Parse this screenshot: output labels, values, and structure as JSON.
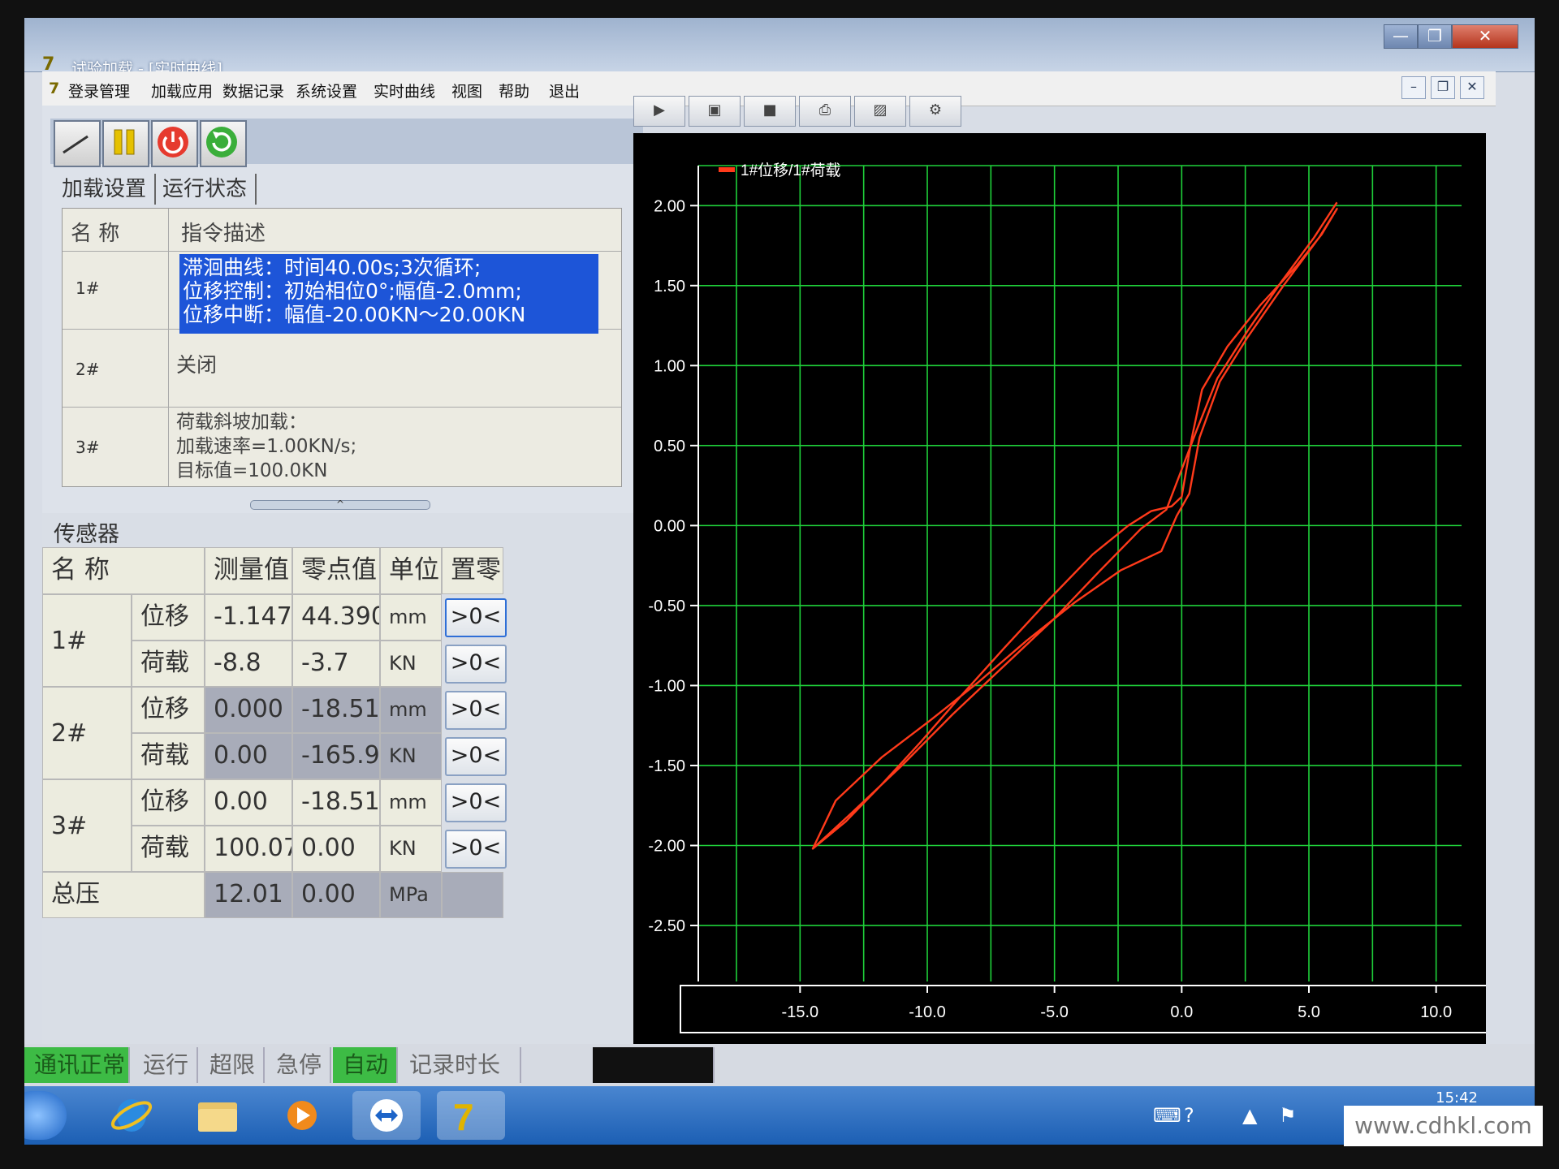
{
  "window": {
    "title": "试验加载 - [实时曲线]",
    "controls": {
      "min": "—",
      "max": "❐",
      "close": "✕"
    },
    "inner_controls": [
      "–",
      "❐",
      "✕"
    ]
  },
  "menu": [
    "登录管理",
    "加载应用",
    "数据记录",
    "系统设置",
    "实时曲线",
    "视图",
    "帮助",
    "退出"
  ],
  "toolbar_icons": [
    "curve-icon",
    "pause-icon",
    "power-icon",
    "refresh-icon"
  ],
  "tabs": [
    "加载设置",
    "运行状态"
  ],
  "command_table": {
    "headers": [
      "名  称",
      "指令描述"
    ],
    "rows": [
      {
        "id": "1#",
        "desc": "滞洄曲线：时间40.00s;3次循环;\n位移控制：初始相位0°;幅值-2.0mm;\n位移中断：幅值-20.00KN～20.00KN"
      },
      {
        "id": "2#",
        "desc": "关闭"
      },
      {
        "id": "3#",
        "desc": "荷载斜坡加载：\n加载速率=1.00KN/s;\n目标值=100.0KN"
      }
    ]
  },
  "splitter_glyph": "^",
  "sensors": {
    "title": "传感器",
    "headers": [
      "名  称",
      "测量值",
      "零点值",
      "单位",
      "置零"
    ],
    "groups": [
      {
        "id": "1#",
        "rows": [
          {
            "name": "位移",
            "value": "-1.147",
            "zero": "44.390",
            "unit": "mm",
            "btn": ">0<"
          },
          {
            "name": "荷载",
            "value": "-8.8",
            "zero": "-3.7",
            "unit": "KN",
            "btn": ">0<"
          }
        ]
      },
      {
        "id": "2#",
        "rows": [
          {
            "name": "位移",
            "value": "0.000",
            "zero": "-18.51",
            "unit": "mm",
            "btn": ">0<"
          },
          {
            "name": "荷载",
            "value": "0.00",
            "zero": "-165.9",
            "unit": "KN",
            "btn": ">0<"
          }
        ]
      },
      {
        "id": "3#",
        "rows": [
          {
            "name": "位移",
            "value": "0.00",
            "zero": "-18.51",
            "unit": "mm",
            "btn": ">0<"
          },
          {
            "name": "荷载",
            "value": "100.07",
            "zero": "0.00",
            "unit": "KN",
            "btn": ">0<"
          }
        ]
      }
    ],
    "total": {
      "name": "总压",
      "value": "12.01",
      "zero": "0.00",
      "unit": "MPa"
    }
  },
  "status": [
    "通讯正常",
    "运行",
    "超限",
    "急停",
    "自动",
    "记录时长"
  ],
  "taskbar": {
    "clock": "15:42"
  },
  "watermark": "www.cdhkl.com",
  "colors": {
    "grid": "#1fd13a",
    "curve": "#ff3a1a",
    "selection": "#1d55d8",
    "chart_bg": "#000000"
  },
  "chart_data": {
    "type": "line",
    "title": "",
    "xlabel": "",
    "ylabel": "",
    "xlim": [
      -19,
      11
    ],
    "ylim": [
      -2.85,
      2.25
    ],
    "x_ticks": [
      "-15.0",
      "-10.0",
      "-5.0",
      "0.0",
      "5.0",
      "10.0"
    ],
    "x_tick_values": [
      -15,
      -10,
      -5,
      0,
      5,
      10
    ],
    "y_ticks": [
      "2.00",
      "1.50",
      "1.00",
      "0.50",
      "0.00",
      "-0.50",
      "-1.00",
      "-1.50",
      "-2.00",
      "-2.50"
    ],
    "y_tick_values": [
      2,
      1.5,
      1,
      0.5,
      0,
      -0.5,
      -1,
      -1.5,
      -2,
      -2.5
    ],
    "grid": true,
    "legend_position": "top-left",
    "series": [
      {
        "name": "1#位移/1#荷载",
        "color": "#ff3a1a",
        "x": [
          -14.5,
          -13.2,
          -11.8,
          -10.3,
          -8.7,
          -7.0,
          -5.2,
          -3.5,
          -2.1,
          -1.2,
          -0.4,
          0.0,
          0.4,
          0.8,
          1.8,
          3.1,
          4.5,
          5.5,
          6.1,
          5.4,
          4.0,
          2.6,
          1.5,
          0.7,
          0.3,
          -0.2,
          -0.8,
          -2.4,
          -4.2,
          -6.1,
          -8.0,
          -9.9,
          -11.8,
          -13.6,
          -14.5,
          -13.0,
          -11.0,
          -9.0,
          -7.0,
          -5.0,
          -3.2,
          -1.6,
          -0.6,
          0.0,
          0.6,
          1.4,
          2.6,
          3.9,
          5.2,
          6.1
        ],
        "y": [
          -2.02,
          -1.85,
          -1.62,
          -1.36,
          -1.07,
          -0.77,
          -0.46,
          -0.18,
          0.0,
          0.09,
          0.12,
          0.18,
          0.55,
          0.85,
          1.12,
          1.38,
          1.62,
          1.82,
          1.98,
          1.8,
          1.5,
          1.18,
          0.9,
          0.55,
          0.2,
          0.06,
          -0.16,
          -0.28,
          -0.48,
          -0.72,
          -0.98,
          -1.22,
          -1.45,
          -1.72,
          -2.02,
          -1.8,
          -1.5,
          -1.18,
          -0.88,
          -0.58,
          -0.28,
          -0.02,
          0.1,
          0.35,
          0.6,
          0.92,
          1.22,
          1.52,
          1.8,
          2.02
        ]
      }
    ]
  }
}
